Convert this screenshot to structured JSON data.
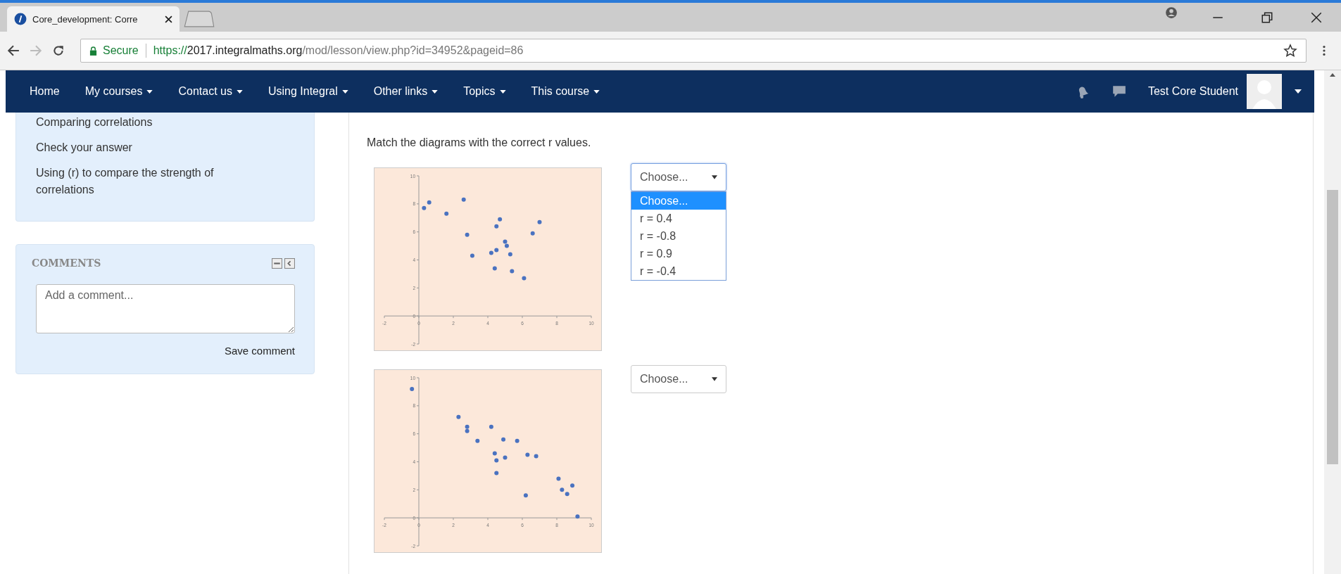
{
  "browser": {
    "tab": {
      "title": "Core_development: Corre"
    },
    "address": {
      "secure_label": "Secure",
      "url_scheme": "https://",
      "url_host": "2017.integralmaths.org",
      "url_path": "/mod/lesson/view.php?id=34952&pageid=86"
    }
  },
  "navbar": {
    "items": [
      {
        "label": "Home",
        "dropdown": false
      },
      {
        "label": "My courses",
        "dropdown": true
      },
      {
        "label": "Contact us",
        "dropdown": true
      },
      {
        "label": "Using Integral",
        "dropdown": true
      },
      {
        "label": "Other links",
        "dropdown": true
      },
      {
        "label": "Topics",
        "dropdown": true
      },
      {
        "label": "This course",
        "dropdown": true
      }
    ],
    "user": {
      "name": "Test Core Student"
    }
  },
  "sidebar": {
    "lesson_links": [
      "Comparing correlations",
      "Check your answer",
      "Using (r) to compare the strength of correlations"
    ],
    "comments": {
      "title": "COMMENTS",
      "placeholder": "Add a comment...",
      "save_label": "Save comment"
    }
  },
  "question": {
    "prompt": "Match the diagrams with the correct r values.",
    "items": [
      {
        "chart_data": {
          "type": "scatter",
          "x": [
            0.3,
            0.6,
            1.6,
            2.6,
            2.8,
            3.1,
            4.2,
            4.4,
            4.5,
            4.5,
            4.7,
            5.0,
            5.1,
            5.3,
            5.4,
            6.1,
            6.6,
            7.0
          ],
          "series": [
            {
              "color": "#4a72c0",
              "values": [
                7.7,
                8.1,
                7.3,
                8.3,
                5.8,
                4.3,
                4.5,
                3.4,
                6.4,
                4.7,
                6.9,
                5.3,
                5.0,
                4.4,
                3.2,
                2.7,
                5.9,
                6.7
              ]
            }
          ],
          "xlim": [
            -2,
            10
          ],
          "ylim": [
            -2,
            10
          ],
          "xticks": [
            -2,
            0,
            2,
            4,
            6,
            8,
            10
          ],
          "yticks": [
            -2,
            0,
            2,
            4,
            6,
            8,
            10
          ]
        },
        "select": {
          "value": "Choose...",
          "expanded": true,
          "options": [
            {
              "label": "Choose...",
              "selected": true
            },
            {
              "label": "r = 0.4",
              "selected": false
            },
            {
              "label": "r = -0.8",
              "selected": false
            },
            {
              "label": "r = 0.9",
              "selected": false
            },
            {
              "label": "r = -0.4",
              "selected": false
            }
          ]
        }
      },
      {
        "chart_data": {
          "type": "scatter",
          "x": [
            -0.4,
            2.3,
            2.8,
            2.8,
            3.4,
            4.2,
            4.4,
            4.5,
            4.5,
            4.9,
            5.0,
            5.7,
            6.2,
            6.3,
            6.8,
            8.1,
            8.3,
            8.6,
            8.9,
            9.2
          ],
          "series": [
            {
              "color": "#4a72c0",
              "values": [
                9.2,
                7.2,
                6.5,
                6.2,
                5.5,
                6.5,
                4.6,
                4.1,
                3.2,
                5.6,
                4.3,
                5.5,
                1.6,
                4.5,
                4.4,
                2.8,
                2.0,
                1.7,
                2.3,
                0.1
              ]
            }
          ],
          "xlim": [
            -2,
            10
          ],
          "ylim": [
            -2,
            10
          ],
          "xticks": [
            -2,
            0,
            2,
            4,
            6,
            8,
            10
          ],
          "yticks": [
            -2,
            0,
            2,
            4,
            6,
            8,
            10
          ]
        },
        "select": {
          "value": "Choose...",
          "expanded": false
        }
      }
    ]
  }
}
